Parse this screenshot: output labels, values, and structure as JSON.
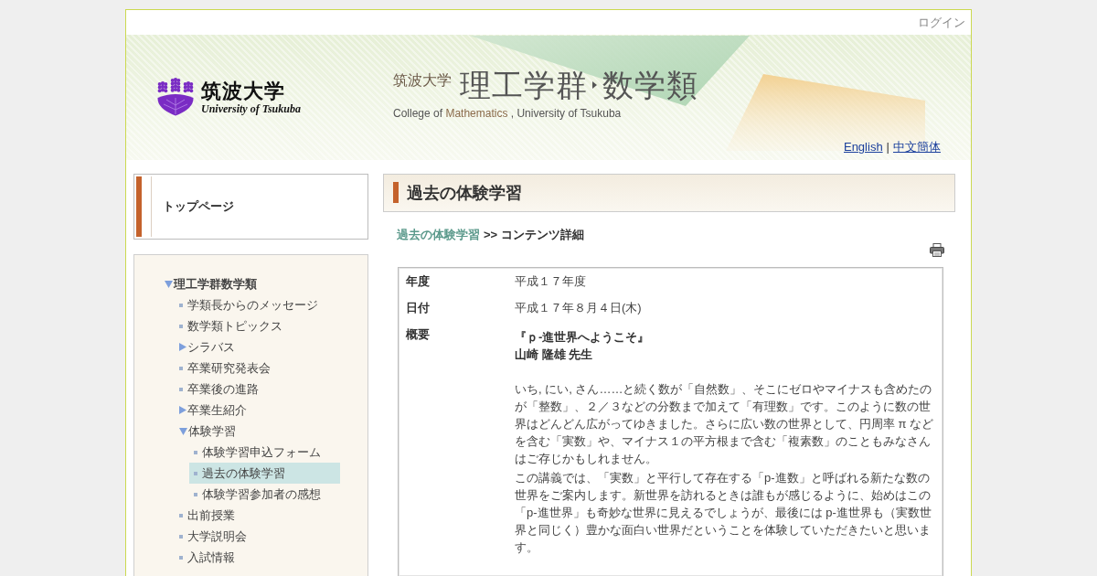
{
  "login": {
    "label": "ログイン"
  },
  "header": {
    "logo": {
      "name": "筑波大学",
      "english": "University of Tsukuba"
    },
    "title": {
      "university": "筑波大学",
      "school": "理工学群",
      "department": "数学類",
      "subtitle": [
        {
          "text": "College of",
          "accent": false
        },
        {
          "text": "Mathematics",
          "accent": true
        },
        {
          "text": ", University of Tsukuba",
          "accent": false
        }
      ]
    },
    "languages": {
      "links": [
        "English",
        "中文簡体"
      ],
      "separator": "|"
    }
  },
  "sidebar": {
    "top_link": "トップページ",
    "menu": [
      {
        "label": "理工学群数学類",
        "kind": "folder",
        "expanded": true,
        "selected": false,
        "children": [
          {
            "label": "学類長からのメッセージ",
            "kind": "page",
            "selected": false
          },
          {
            "label": "数学類トピックス",
            "kind": "page",
            "selected": false
          },
          {
            "label": "シラバス",
            "kind": "folder",
            "expanded": false,
            "selected": false
          },
          {
            "label": "卒業研究発表会",
            "kind": "page",
            "selected": false
          },
          {
            "label": "卒業後の進路",
            "kind": "page",
            "selected": false
          },
          {
            "label": "卒業生紹介",
            "kind": "folder",
            "expanded": false,
            "selected": false
          },
          {
            "label": "体験学習",
            "kind": "folder",
            "expanded": true,
            "selected": false,
            "children": [
              {
                "label": "体験学習申込フォーム",
                "kind": "page",
                "selected": false
              },
              {
                "label": "過去の体験学習",
                "kind": "page",
                "selected": true
              },
              {
                "label": "体験学習参加者の感想",
                "kind": "page",
                "selected": false
              }
            ]
          },
          {
            "label": "出前授業",
            "kind": "page",
            "selected": false
          },
          {
            "label": "大学説明会",
            "kind": "page",
            "selected": false
          },
          {
            "label": "入試情報",
            "kind": "page",
            "selected": false
          }
        ]
      }
    ]
  },
  "content": {
    "heading": "過去の体験学習",
    "breadcrumb": {
      "link": "過去の体験学習",
      "separator": ">>",
      "current": "コンテンツ詳細"
    },
    "table": {
      "rows": [
        {
          "kind": "text",
          "label": "年度",
          "value": "平成１７年度"
        },
        {
          "kind": "text",
          "label": "日付",
          "value": "平成１７年８月４日(木)"
        },
        {
          "kind": "summary",
          "label": "概要",
          "title": "『ｐ-進世界へようこそ』",
          "lecturer": "山崎 隆雄 先生",
          "paragraphs": [
            "いち, にい, さん……と続く数が「自然数」、そこにゼロやマイナスも含めたのが「整数」、２／３などの分数まで加えて「有理数」です。このように数の世界はどんどん広がってゆきました。さらに広い数の世界として、円周率 π などを含む「実数」や、マイナス１の平方根まで含む「複素数」のこともみなさんはご存じかもしれません。",
            "この講義では、「実数」と平行して存在する「p-進数」と呼ばれる新たな数の世界をご案内します。新世界を訪れるときは誰もが感じるように、始めはこの「p-進世界」も奇妙な世界に見えるでしょうが、最後には p-進世界も（実数世界と同じく）豊かな面白い世界だということを体験していただきたいと思います。"
          ]
        }
      ]
    }
  }
}
